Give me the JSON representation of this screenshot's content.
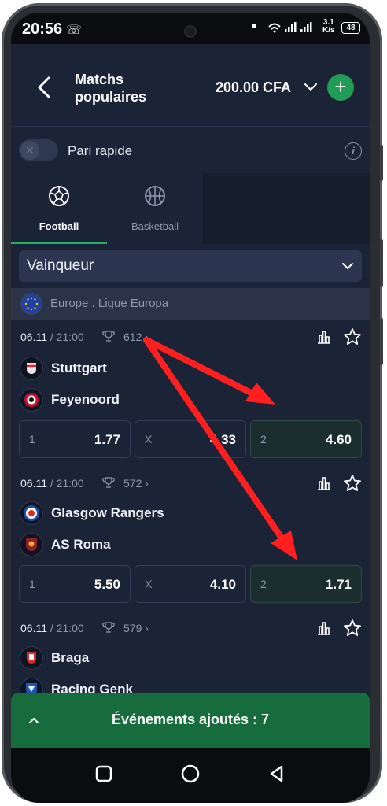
{
  "status_bar": {
    "time": "20:56",
    "net_speed_value": "3.1",
    "net_speed_unit": "K/s",
    "battery": "48"
  },
  "header": {
    "title": "Matchs populaires",
    "balance": "200.00 CFA",
    "add_label": "+"
  },
  "quick_bet": {
    "label": "Pari rapide"
  },
  "sports": [
    {
      "label": "Football",
      "active": true
    },
    {
      "label": "Basketball",
      "active": false
    }
  ],
  "market": {
    "label": "Vainqueur"
  },
  "league": {
    "name": "Europe . Ligue Europa"
  },
  "matches": [
    {
      "date": "06.11",
      "time": "21:00",
      "count": "612",
      "home": "Stuttgart",
      "away": "Feyenoord",
      "odds": [
        {
          "label": "1",
          "value": "1.77"
        },
        {
          "label": "X",
          "value": "4.33"
        },
        {
          "label": "2",
          "value": "4.60",
          "selected": true
        }
      ]
    },
    {
      "date": "06.11",
      "time": "21:00",
      "count": "572",
      "home": "Glasgow Rangers",
      "away": "AS Roma",
      "odds": [
        {
          "label": "1",
          "value": "5.50"
        },
        {
          "label": "X",
          "value": "4.10"
        },
        {
          "label": "2",
          "value": "1.71",
          "selected": true
        }
      ]
    },
    {
      "date": "06.11",
      "time": "21:00",
      "count": "579",
      "home": "Braga",
      "away": "Racing Genk"
    }
  ],
  "events_bar": {
    "label": "Événements ajoutés : 7"
  },
  "colors": {
    "background": "#1b2336",
    "accent_green": "#1f9d55",
    "events_bar": "#176c3d",
    "annotation_arrow": "#ff1f1f"
  }
}
